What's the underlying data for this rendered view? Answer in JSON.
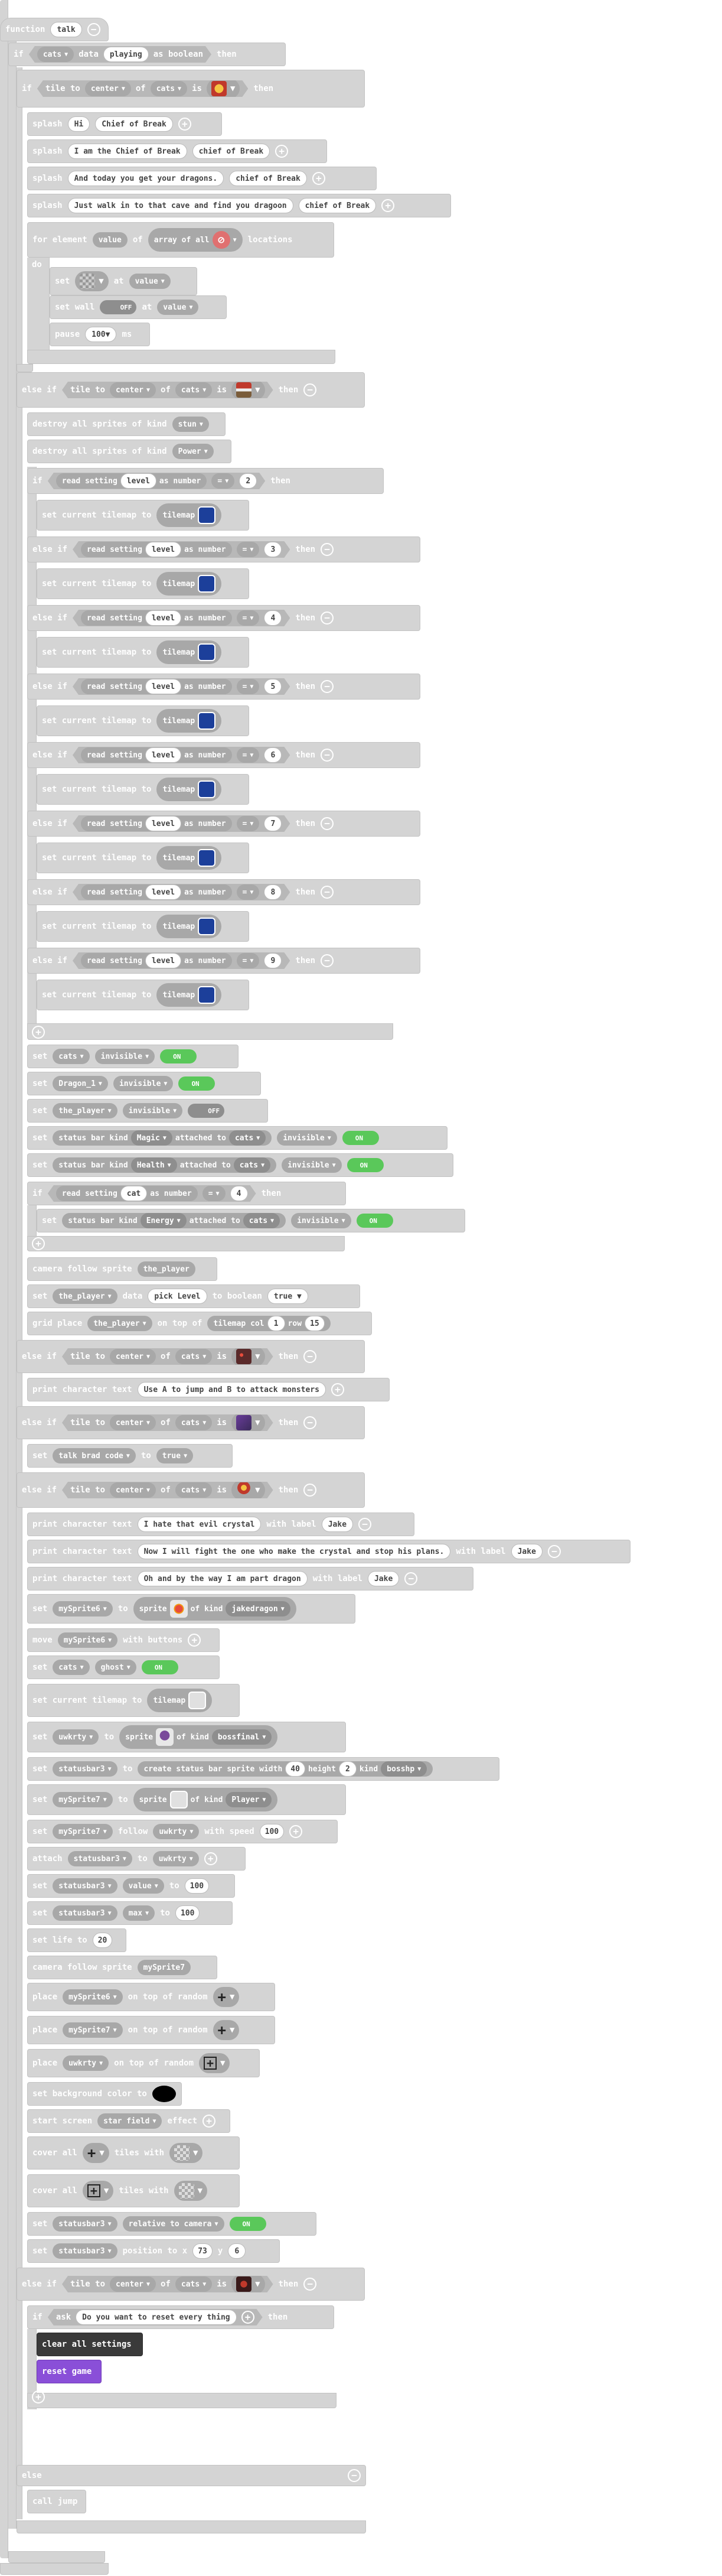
{
  "function_block": {
    "keyword": "function",
    "name": "talk"
  },
  "blocks": {
    "if_cats_playing": {
      "if": "if",
      "sprite": "cats",
      "data": "data",
      "key": "playing",
      "as": "as boolean",
      "then": "then"
    },
    "if_tile_center_1": {
      "if": "if",
      "tile_to": "tile to",
      "center": "center",
      "of": "of",
      "sprite": "cats",
      "is": "is",
      "then": "then"
    },
    "splash1": {
      "kw": "splash",
      "a": "Hi",
      "b": "Chief of Break"
    },
    "splash2": {
      "kw": "splash",
      "a": "I am the Chief of Break",
      "b": "chief of Break"
    },
    "splash3": {
      "kw": "splash",
      "a": "And today you get your dragons.",
      "b": "chief of Break"
    },
    "splash4": {
      "kw": "splash",
      "a": "Just walk in to that cave and find you dragoon",
      "b": "chief of Break"
    },
    "for_element": {
      "for": "for element",
      "var": "value",
      "of": "of",
      "arr": "array of all",
      "loc": "locations"
    },
    "do_label": "do",
    "set_value": {
      "set": "set",
      "at": "at",
      "var": "value"
    },
    "set_wall": {
      "set": "set wall",
      "state": "OFF",
      "at": "at",
      "var": "value"
    },
    "pause": {
      "kw": "pause",
      "val": "100",
      "ms": "ms"
    },
    "elseif_tile_2": {
      "kw": "else if",
      "tile_to": "tile to",
      "center": "center",
      "of": "of",
      "sprite": "cats",
      "is": "is",
      "then": "then"
    },
    "destroy1": {
      "kw": "destroy all sprites of kind",
      "kind": "stun"
    },
    "destroy2": {
      "kw": "destroy all sprites of kind",
      "kind": "Power"
    },
    "level_if": [
      {
        "kw": "if",
        "read": "read setting",
        "key": "level",
        "as": "as number",
        "op": "=",
        "n": "2",
        "then": "then",
        "set": "set current tilemap to",
        "tm": "tilemap"
      },
      {
        "kw": "else if",
        "read": "read setting",
        "key": "level",
        "as": "as number",
        "op": "=",
        "n": "3",
        "then": "then",
        "set": "set current tilemap to",
        "tm": "tilemap"
      },
      {
        "kw": "else if",
        "read": "read setting",
        "key": "level",
        "as": "as number",
        "op": "=",
        "n": "4",
        "then": "then",
        "set": "set current tilemap to",
        "tm": "tilemap"
      },
      {
        "kw": "else if",
        "read": "read setting",
        "key": "level",
        "as": "as number",
        "op": "=",
        "n": "5",
        "then": "then",
        "set": "set current tilemap to",
        "tm": "tilemap"
      },
      {
        "kw": "else if",
        "read": "read setting",
        "key": "level",
        "as": "as number",
        "op": "=",
        "n": "6",
        "then": "then",
        "set": "set current tilemap to",
        "tm": "tilemap"
      },
      {
        "kw": "else if",
        "read": "read setting",
        "key": "level",
        "as": "as number",
        "op": "=",
        "n": "7",
        "then": "then",
        "set": "set current tilemap to",
        "tm": "tilemap"
      },
      {
        "kw": "else if",
        "read": "read setting",
        "key": "level",
        "as": "as number",
        "op": "=",
        "n": "8",
        "then": "then",
        "set": "set current tilemap to",
        "tm": "tilemap"
      },
      {
        "kw": "else if",
        "read": "read setting",
        "key": "level",
        "as": "as number",
        "op": "=",
        "n": "9",
        "then": "then",
        "set": "set current tilemap to",
        "tm": "tilemap"
      }
    ],
    "set_cats_inv": {
      "set": "set",
      "sprite": "cats",
      "prop": "invisible",
      "val": "ON"
    },
    "set_dragon_inv": {
      "set": "set",
      "sprite": "Dragon_1",
      "prop": "invisible",
      "val": "ON"
    },
    "set_player_inv": {
      "set": "set",
      "sprite": "the_player",
      "prop": "invisible",
      "val": "OFF"
    },
    "set_statusbar_magic": {
      "set": "set",
      "sb": "status bar kind",
      "kind": "Magic",
      "att": "attached to",
      "sprite": "cats",
      "prop": "invisible",
      "val": "ON"
    },
    "set_statusbar_health": {
      "set": "set",
      "sb": "status bar kind",
      "kind": "Health",
      "att": "attached to",
      "sprite": "cats",
      "prop": "invisible",
      "val": "ON"
    },
    "if_cat_4": {
      "kw": "if",
      "read": "read setting",
      "key": "cat",
      "as": "as number",
      "op": "=",
      "n": "4",
      "then": "then"
    },
    "set_statusbar_energy": {
      "set": "set",
      "sb": "status bar kind",
      "kind": "Energy",
      "att": "attached to",
      "sprite": "cats",
      "prop": "invisible",
      "val": "ON"
    },
    "camera_follow1": {
      "kw": "camera follow sprite",
      "sprite": "the_player"
    },
    "set_pick_level": {
      "set": "set",
      "sprite": "the_player",
      "data": "data",
      "key": "pick Level",
      "to": "to boolean",
      "val": "true"
    },
    "grid_place": {
      "kw": "grid place",
      "sprite": "the_player",
      "on": "on top of",
      "tm": "tilemap col",
      "col": "1",
      "row_lbl": "row",
      "row": "15"
    },
    "elseif_tile_3": {
      "kw": "else if",
      "tile_to": "tile to",
      "center": "center",
      "of": "of",
      "sprite": "cats",
      "is": "is",
      "then": "then"
    },
    "print1": {
      "kw": "print character text",
      "text": "Use  A to jump and B to attack monsters"
    },
    "elseif_tile_4": {
      "kw": "else if",
      "tile_to": "tile to",
      "center": "center",
      "of": "of",
      "sprite": "cats",
      "is": "is",
      "then": "then"
    },
    "set_talk_brad": {
      "set": "set",
      "var": "talk brad code",
      "to": "to",
      "val": "true"
    },
    "elseif_tile_5": {
      "kw": "else if",
      "tile_to": "tile to",
      "center": "center",
      "of": "of",
      "sprite": "cats",
      "is": "is",
      "then": "then"
    },
    "print2": {
      "kw": "print character text",
      "text": "I hate that evil crystal",
      "label": "with label",
      "who": "Jake"
    },
    "print3": {
      "kw": "print character text",
      "text": "Now I will fight the one who make the crystal and stop his plans.",
      "label": "with label",
      "who": "Jake"
    },
    "print4": {
      "kw": "print character text",
      "text": "Oh and by the way I am part dragon",
      "label": "with label",
      "who": "Jake"
    },
    "set_mysprite6": {
      "set": "set",
      "var": "mySprite6",
      "to": "to",
      "sp": "sprite",
      "of": "of kind",
      "kind": "jakedragon"
    },
    "move_mysprite6": {
      "kw": "move",
      "var": "mySprite6",
      "with": "with buttons"
    },
    "set_cats_ghost": {
      "set": "set",
      "sprite": "cats",
      "prop": "ghost",
      "val": "ON"
    },
    "set_tilemap": {
      "kw": "set current tilemap to",
      "tm": "tilemap"
    },
    "set_uwkrty": {
      "set": "set",
      "var": "uwkrty",
      "to": "to",
      "sp": "sprite",
      "of": "of kind",
      "kind": "bossfinal"
    },
    "set_statusbar3": {
      "set": "set",
      "var": "statusbar3",
      "to": "to",
      "create": "create status bar sprite width",
      "w": "40",
      "h_lbl": "height",
      "h": "2",
      "kind_lbl": "kind",
      "kind": "bosshp"
    },
    "set_mysprite7": {
      "set": "set",
      "var": "mySprite7",
      "to": "to",
      "sp": "sprite",
      "of": "of kind",
      "kind": "Player"
    },
    "follow": {
      "set": "set",
      "var": "mySprite7",
      "follow": "follow",
      "target": "uwkrty",
      "speed_lbl": "with speed",
      "speed": "100"
    },
    "attach": {
      "kw": "attach",
      "var": "statusbar3",
      "to": "to",
      "target": "uwkrty"
    },
    "set_sb_value": {
      "set": "set",
      "var": "statusbar3",
      "prop": "value",
      "to": "to",
      "val": "100"
    },
    "set_sb_max": {
      "set": "set",
      "var": "statusbar3",
      "prop": "max",
      "to": "to",
      "val": "100"
    },
    "set_life": {
      "kw": "set life to",
      "val": "20"
    },
    "camera_follow2": {
      "kw": "camera follow sprite",
      "sprite": "mySprite7"
    },
    "place1": {
      "kw": "place",
      "var": "mySprite6",
      "on": "on top of random"
    },
    "place2": {
      "kw": "place",
      "var": "mySprite7",
      "on": "on top of random"
    },
    "place3": {
      "kw": "place",
      "var": "uwkrty",
      "on": "on top of random"
    },
    "bg_color": {
      "kw": "set background color to"
    },
    "start_screen": {
      "kw": "start screen",
      "effect": "star field",
      "lbl": "effect"
    },
    "cover1": {
      "kw": "cover all",
      "with": "tiles with"
    },
    "cover2": {
      "kw": "cover all",
      "with": "tiles with"
    },
    "set_sb_camera": {
      "set": "set",
      "var": "statusbar3",
      "prop": "relative to camera",
      "val": "ON"
    },
    "set_sb_position": {
      "set": "set",
      "var": "statusbar3",
      "prop": "position to x",
      "x": "73",
      "y_lbl": "y",
      "y": "6"
    },
    "elseif_tile_6": {
      "kw": "else if",
      "tile_to": "tile to",
      "center": "center",
      "of": "of",
      "sprite": "cats",
      "is": "is",
      "then": "then"
    },
    "if_ask": {
      "kw": "if",
      "ask": "ask",
      "text": "Do you want to reset every thing",
      "then": "then"
    },
    "clear_settings": "clear all settings",
    "reset_game": "reset game",
    "else_label": "else",
    "call_jump": {
      "kw": "call",
      "fn": "jump"
    }
  },
  "icons": {
    "dropdown": "dropdown-arrow",
    "add": "plus-circle",
    "remove": "minus-circle"
  }
}
